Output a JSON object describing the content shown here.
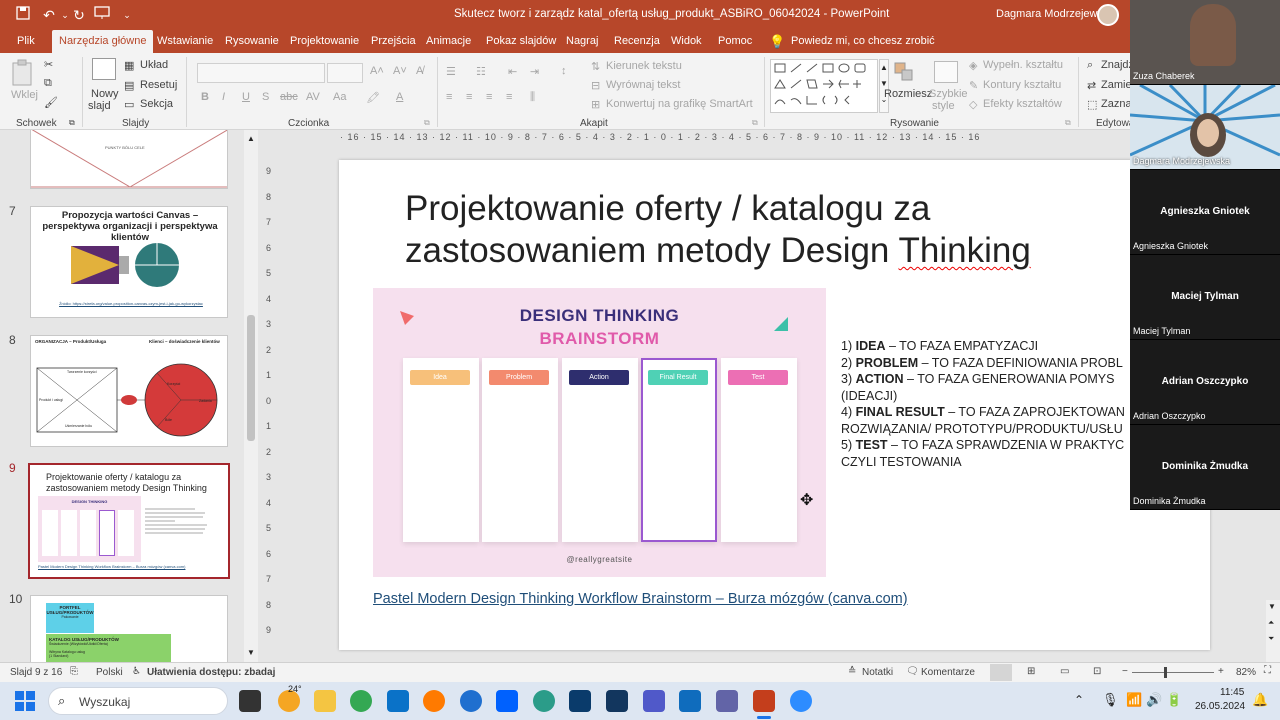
{
  "window": {
    "doc_title": "Skutecz tworz i zarządz  katal_ofertą usług_produkt_ASBiRO_06042024  -  PowerPoint",
    "user_name": "Dagmara Modrzejewska"
  },
  "tabs": [
    "Plik",
    "Narzędzia główne",
    "Wstawianie",
    "Rysowanie",
    "Projektowanie",
    "Przejścia",
    "Animacje",
    "Pokaz slajdów",
    "Nagraj",
    "Recenzja",
    "Widok",
    "Pomoc"
  ],
  "tell_me": "Powiedz mi, co chcesz zrobić",
  "ribbon": {
    "clipboard": {
      "paste": "Wklej",
      "label": "Schowek"
    },
    "slides": {
      "new_slide_1": "Nowy",
      "new_slide_2": "slajd",
      "layout": "Układ",
      "reset": "Resetuj",
      "section": "Sekcja",
      "label": "Slajdy"
    },
    "font": {
      "label": "Czcionka"
    },
    "paragraph": {
      "text_direction": "Kierunek tekstu",
      "align_text": "Wyrównaj tekst",
      "smartart": "Konwertuj na grafikę SmartArt",
      "label": "Akapit"
    },
    "drawing": {
      "arrange": "Rozmiesz",
      "quick_styles_1": "Szybkie",
      "quick_styles_2": "style",
      "fill": "Wypełn. kształtu",
      "outline": "Kontury kształtu",
      "effects": "Efekty kształtów",
      "label": "Rysowanie"
    },
    "editing": {
      "find": "Znajdź",
      "replace": "Zamień",
      "select": "Zaznac",
      "label": "Edytowa"
    }
  },
  "slides": [
    {
      "num": "7",
      "title": "Propozycja wartości Canvas – perspektywa organizacji i perspektywa klientów",
      "caption": "Źródło: https://strefa.org/value-proposition-canvas-czym-jest-i-jak-go-wykorzystac"
    },
    {
      "num": "8",
      "left_title": "ORGANIZACJA – Produkt/Usługa",
      "right_title": "Klienci – doświadczenie klientów",
      "box1": "Tworzenie korzyści",
      "box2": "Produkt i usługi",
      "box3": "Uśmierzanie bólu",
      "c1": "Korzyści",
      "c2": "Zadania",
      "c3": "Bóle"
    },
    {
      "num": "9",
      "title": "Projektowanie oferty / katalogu za zastosowaniem metody Design Thinking",
      "caption": "Pastel Modern Design Thinking Workflow Brainstorm – Burza mózgów (canva.com)"
    },
    {
      "num": "10",
      "title": "PORTFEL USŁUG/PRODUKTÓW",
      "sub": "Pakowanie",
      "katalog": "KATALOG USŁUG/PRODUKTÓW",
      "katalog_sub": "Świadczenie (Wizytówki/Ulotki/Oferta)",
      "portal": "Witryna Katalogu usług",
      "portal_sub": "(1 Standard)"
    }
  ],
  "slide6_partial": {
    "label": "PUNKTY BÓLU     CELE"
  },
  "current_slide": {
    "title_line1": "Projektowanie oferty / katalogu za",
    "title_line2_a": "zastosowaniem metody Design ",
    "title_line2_b": "Thinking",
    "image": {
      "heading1": "DESIGN THINKING",
      "heading2": "BRAINSTORM",
      "columns": [
        {
          "label": "Idea",
          "color": "#f7c07a"
        },
        {
          "label": "Problem",
          "color": "#f38a6e"
        },
        {
          "label": "Action",
          "color": "#2e2e6e"
        },
        {
          "label": "Final Result",
          "color": "#4fd1b5"
        },
        {
          "label": "Test",
          "color": "#ec6fb4"
        }
      ],
      "handle": "@reallygreatsite",
      "heading1_color": "#3a2f7a",
      "heading2_color": "#e05aaa"
    },
    "phases": [
      {
        "num": "1)",
        "key": "IDEA",
        "rest": " – TO FAZA EMPATYZACJI"
      },
      {
        "num": "2)",
        "key": "PROBLEM",
        "rest": " – TO FAZA DEFINIOWANIA PROBL"
      },
      {
        "num": "3)",
        "key": "ACTION",
        "rest": " – TO FAZA GENEROWANIA POMYS"
      },
      {
        "cont": "(IDEACJI)"
      },
      {
        "num": "4)",
        "key": "FINAL RESULT",
        "rest": " – TO FAZA ZAPROJEKTOWAN"
      },
      {
        "cont": "ROZWIĄZANIA/ PROTOTYPU/PRODUKTU/USŁU"
      },
      {
        "num": "5)",
        "key": "TEST",
        "rest": " – TO FAZA SPRAWDZENIA W PRAKTYC"
      },
      {
        "cont": "CZYLI TESTOWANIA"
      }
    ],
    "link": "Pastel Modern Design Thinking Workflow Brainstorm – Burza mózgów (canva.com)"
  },
  "ruler_h": "· 16 · 15 · 14 · 13 · 12 · 11 · 10 · 9 · 8 · 7 · 6 · 5 · 4 · 3 · 2 · 1 · 0 · 1 · 2 · 3 · 4 · 5 · 6 · 7 · 8 · 9 · 10 · 11 · 12 · 13 · 14 · 15 · 16",
  "ruler_v": [
    "9",
    "8",
    "7",
    "6",
    "5",
    "4",
    "3",
    "2",
    "1",
    "0",
    "1",
    "2",
    "3",
    "4",
    "5",
    "6",
    "7",
    "8",
    "9"
  ],
  "statusbar": {
    "slide_info": "Slajd 9 z 16",
    "language": "Polski",
    "accessibility": "Ułatwienia dostępu: zbadaj",
    "notes": "Notatki",
    "comments": "Komentarze",
    "zoom": "82%"
  },
  "taskbar": {
    "search": "Wyszukaj",
    "weather": "24°",
    "time": "11:45",
    "date": "26.05.2024"
  },
  "video_tiles": [
    {
      "name": "Zuza Chaberek",
      "type": "video"
    },
    {
      "name": "Dagmara Modrzejewska",
      "type": "video"
    },
    {
      "name": "Agnieszka Gniotek",
      "type": "name"
    },
    {
      "name": "Maciej Tylman",
      "type": "name"
    },
    {
      "name": "Adrian Oszczypko",
      "type": "name"
    },
    {
      "name": "Dominika Żmudka",
      "type": "name"
    }
  ]
}
